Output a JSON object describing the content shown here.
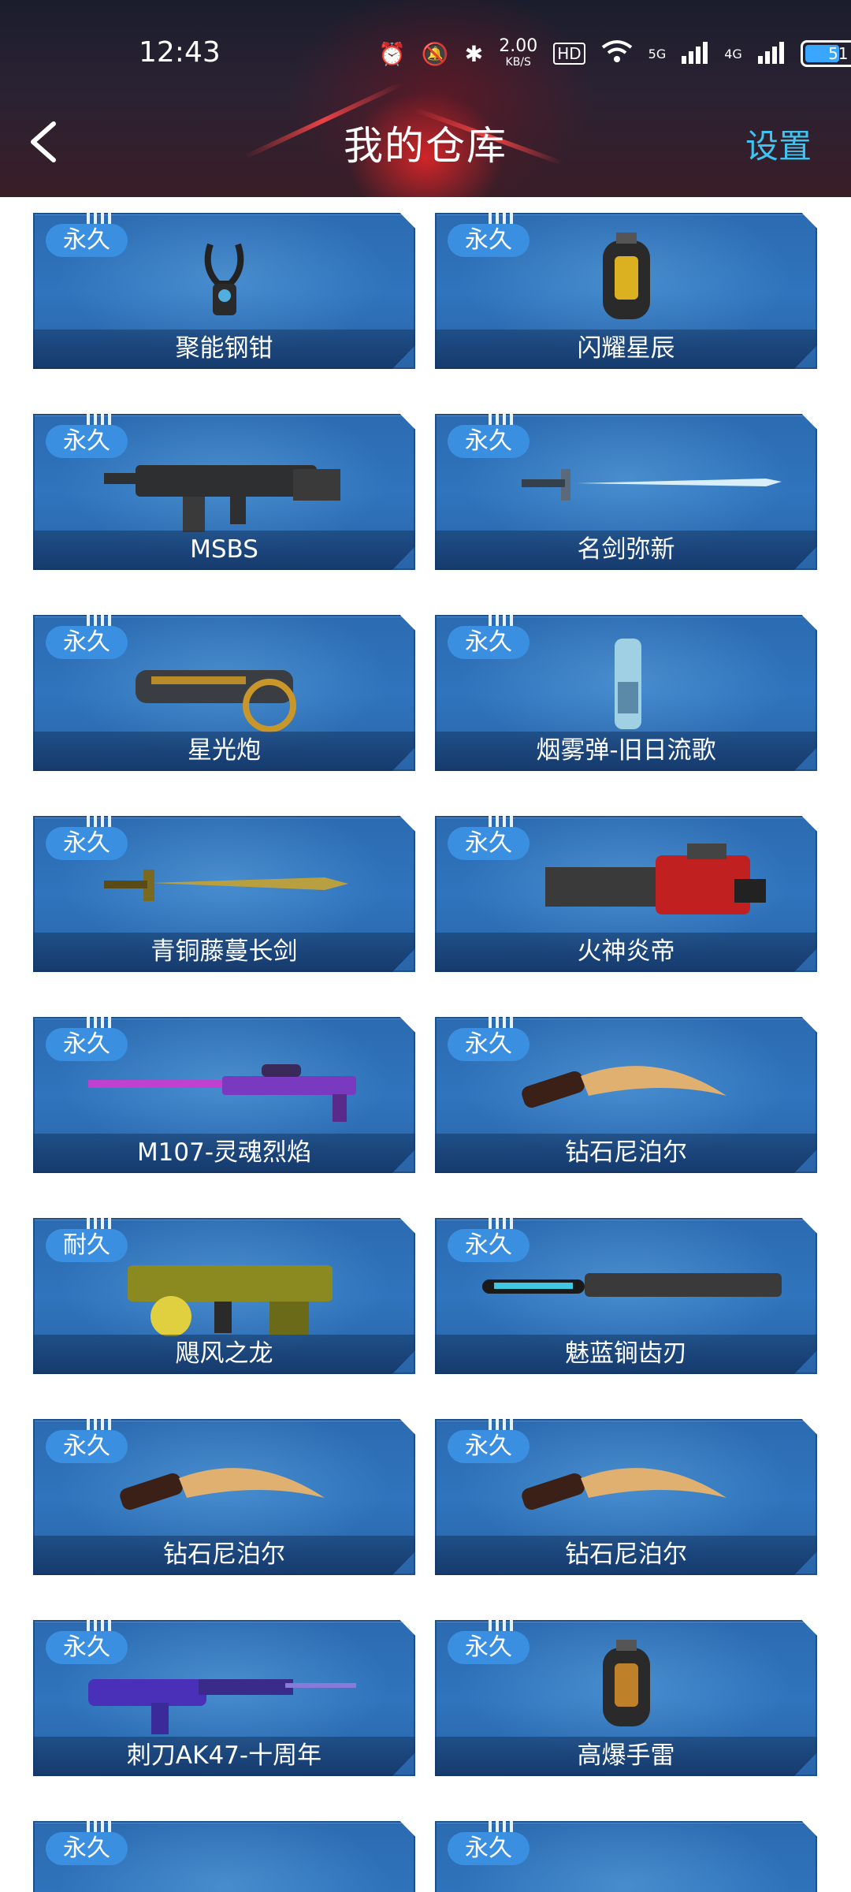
{
  "status_bar": {
    "time": "12:43",
    "net_speed_value": "2.00",
    "net_speed_unit": "KB/S",
    "hd_label": "HD",
    "signal_5g": "5G",
    "signal_4g": "4G",
    "battery_level": "51",
    "battery_fraction": 0.51
  },
  "header": {
    "title": "我的仓库",
    "settings_label": "设置"
  },
  "items": [
    {
      "badge": "永久",
      "name": "聚能钢钳",
      "icon": "claw-icon"
    },
    {
      "badge": "永久",
      "name": "闪耀星辰",
      "icon": "grenade-icon"
    },
    {
      "badge": "永久",
      "name": "MSBS",
      "icon": "rifle-icon"
    },
    {
      "badge": "永久",
      "name": "名剑弥新",
      "icon": "sword-icon"
    },
    {
      "badge": "永久",
      "name": "星光炮",
      "icon": "cannon-icon"
    },
    {
      "badge": "永久",
      "name": "烟雾弹-旧日流歌",
      "icon": "smoke-grenade-icon"
    },
    {
      "badge": "永久",
      "name": "青铜藤蔓长剑",
      "icon": "bronze-sword-icon"
    },
    {
      "badge": "永久",
      "name": "火神炎帝",
      "icon": "minigun-icon"
    },
    {
      "badge": "永久",
      "name": "M107-灵魂烈焰",
      "icon": "sniper-rifle-icon"
    },
    {
      "badge": "永久",
      "name": "钻石尼泊尔",
      "icon": "kukri-knife-icon"
    },
    {
      "badge": "耐久",
      "name": "飓风之龙",
      "icon": "drum-rifle-icon"
    },
    {
      "badge": "永久",
      "name": "魅蓝锏齿刃",
      "icon": "saw-blade-icon"
    },
    {
      "badge": "永久",
      "name": "钻石尼泊尔",
      "icon": "kukri-knife-icon"
    },
    {
      "badge": "永久",
      "name": "钻石尼泊尔",
      "icon": "kukri-knife-icon"
    },
    {
      "badge": "永久",
      "name": "刺刀AK47-十周年",
      "icon": "ak47-icon"
    },
    {
      "badge": "永久",
      "name": "高爆手雷",
      "icon": "frag-grenade-icon"
    },
    {
      "badge": "永久",
      "name": "",
      "icon": "orb-icon"
    },
    {
      "badge": "永久",
      "name": "",
      "icon": "purple-orb-icon"
    }
  ],
  "colors": {
    "card_blue": "#2f74bd",
    "badge_blue": "#3b8fe0",
    "settings_cyan": "#3fc3f0"
  }
}
